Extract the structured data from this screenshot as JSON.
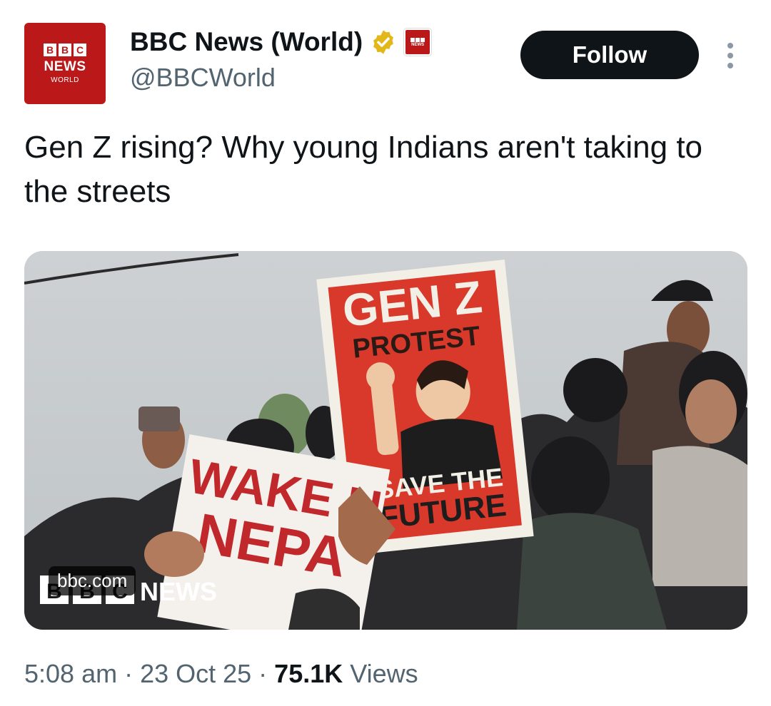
{
  "account": {
    "display_name": "BBC News (World)",
    "handle": "@BBCWorld",
    "avatar": {
      "blocks": [
        "B",
        "B",
        "C"
      ],
      "line1": "NEWS",
      "line2": "WORLD"
    },
    "verified_icon": "verified-badge-icon",
    "affiliation_icon": "bbc-affiliate-badge-icon"
  },
  "actions": {
    "follow_label": "Follow",
    "more_icon": "more-vertical-icon"
  },
  "tweet": {
    "text": "Gen Z rising? Why young Indians aren't taking to the streets"
  },
  "media": {
    "link_label": "bbc.com",
    "sign_top": "GEN Z",
    "sign_mid": "PROTEST",
    "sign_bottom1": "SAVE THE",
    "sign_bottom2": "FUTURE",
    "banner_line1": "WAKE U",
    "banner_line2": "NEPA",
    "watermark_blocks": [
      "B",
      "B",
      "C"
    ],
    "watermark_text": "NEWS"
  },
  "meta": {
    "time": "5:08 am",
    "sep1": " · ",
    "date": "23 Oct 25",
    "sep2": " · ",
    "views_count": "75.1K",
    "views_label": " Views"
  },
  "colors": {
    "brand_red": "#bb1919",
    "verified_gold": "#e2b719",
    "text": "#0f1419",
    "muted": "#536471"
  }
}
